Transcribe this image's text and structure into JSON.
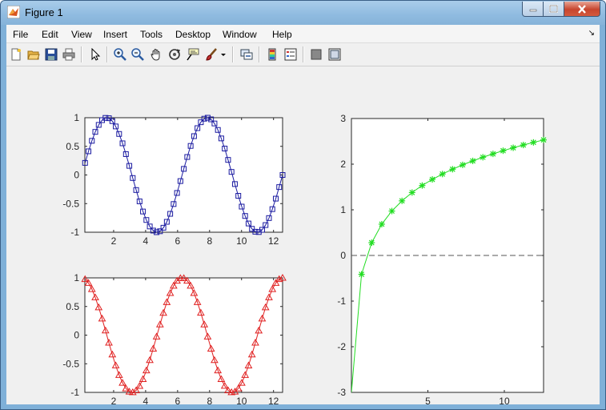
{
  "window": {
    "title": "Figure 1"
  },
  "menu": [
    "File",
    "Edit",
    "View",
    "Insert",
    "Tools",
    "Desktop",
    "Window",
    "Help"
  ],
  "toolbar_icons": [
    "new-figure-icon",
    "open-file-icon",
    "save-icon",
    "print-icon",
    "edit-plot-arrow-icon",
    "zoom-in-icon",
    "zoom-out-icon",
    "pan-hand-icon",
    "rotate-3d-icon",
    "data-cursor-icon",
    "brush-icon",
    "brush-dropdown-icon",
    "link-plot-icon",
    "insert-colorbar-icon",
    "insert-legend-icon",
    "hide-plot-tools-icon",
    "show-plot-tools-icon"
  ],
  "chart_data": [
    {
      "type": "line",
      "x_function": "sin(t)",
      "xlim": [
        0.2,
        12.566
      ],
      "ylim": [
        -1,
        1
      ],
      "xticks": [
        2,
        4,
        6,
        8,
        10,
        12
      ],
      "yticks": [
        -1,
        -0.5,
        0,
        0.5,
        1
      ],
      "xtick_labels": [
        "2",
        "4",
        "6",
        "8",
        "10",
        "12"
      ],
      "ytick_labels": [
        "-1",
        "-0.5",
        "0",
        "0.5",
        "1"
      ],
      "series": [
        {
          "marker": "square",
          "color": "#1a1aa0",
          "points": 60,
          "t_range": [
            0,
            12.566
          ]
        }
      ]
    },
    {
      "type": "line",
      "x_function": "cos(t)",
      "xlim": [
        0.2,
        12.566
      ],
      "ylim": [
        -1,
        1
      ],
      "xticks": [
        2,
        4,
        6,
        8,
        10,
        12
      ],
      "yticks": [
        -1,
        -0.5,
        0,
        0.5,
        1
      ],
      "xtick_labels": [
        "2",
        "4",
        "6",
        "8",
        "10",
        "12"
      ],
      "ytick_labels": [
        "-1",
        "-0.5",
        "0",
        "0.5",
        "1"
      ],
      "series": [
        {
          "marker": "triangle",
          "color": "#e02020",
          "points": 60,
          "t_range": [
            0,
            12.566
          ]
        }
      ]
    },
    {
      "type": "line",
      "x_function": "log(t)",
      "xlim": [
        0,
        12.566
      ],
      "ylim": [
        -3,
        3
      ],
      "xticks": [
        5,
        10
      ],
      "yticks": [
        -3,
        -2,
        -1,
        0,
        1,
        2,
        3
      ],
      "xtick_labels": [
        "5",
        "10"
      ],
      "ytick_labels": [
        "-3",
        "-2",
        "-1",
        "0",
        "1",
        "2",
        "3"
      ],
      "reference_line": {
        "y": 0,
        "style": "dashed"
      },
      "series": [
        {
          "marker": "asterisk",
          "color": "#22dd22",
          "points": 20,
          "t_range": [
            0,
            12.566
          ]
        }
      ]
    }
  ]
}
